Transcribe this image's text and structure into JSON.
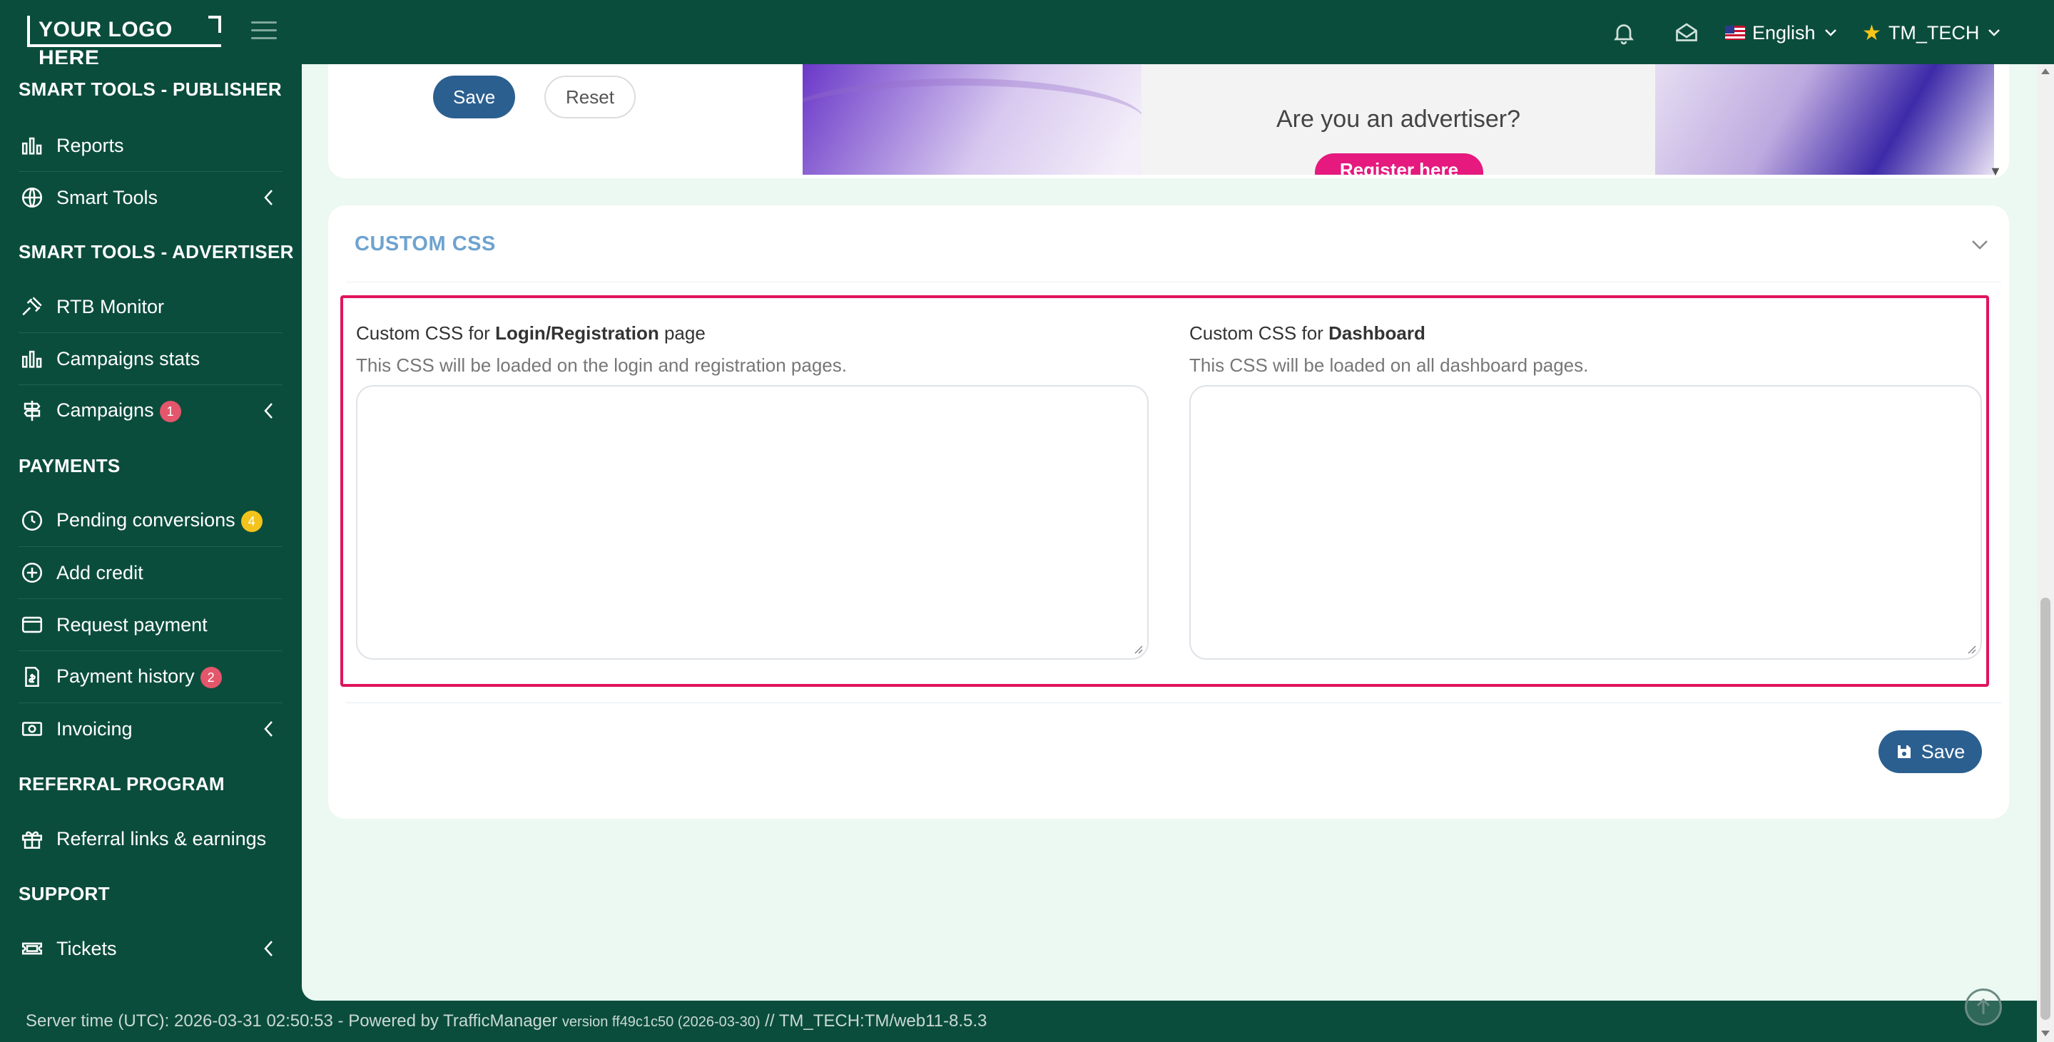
{
  "topbar": {
    "logo": "YOUR LOGO HERE",
    "language": "English",
    "user": "TM_TECH"
  },
  "sidebar": {
    "publisher_title": "SMART TOOLS - PUBLISHER",
    "publisher_items": [
      {
        "label": "Reports"
      },
      {
        "label": "Smart Tools"
      }
    ],
    "advertiser_title": "SMART TOOLS - ADVERTISER",
    "advertiser_items": [
      {
        "label": "RTB Monitor"
      },
      {
        "label": "Campaigns stats"
      },
      {
        "label": "Campaigns",
        "badge": "1"
      }
    ],
    "payments_title": "PAYMENTS",
    "payments_items": [
      {
        "label": "Pending conversions",
        "badge": "4"
      },
      {
        "label": "Add credit"
      },
      {
        "label": "Request payment"
      },
      {
        "label": "Payment history",
        "badge": "2"
      },
      {
        "label": "Invoicing"
      }
    ],
    "referral_title": "REFERRAL PROGRAM",
    "referral_items": [
      {
        "label": "Referral links & earnings"
      }
    ],
    "support_title": "SUPPORT",
    "support_items": [
      {
        "label": "Tickets"
      }
    ]
  },
  "top_card": {
    "save_label": "Save",
    "reset_label": "Reset",
    "preview_question": "Are you an advertiser?",
    "preview_button": "Register here"
  },
  "custom_css": {
    "title": "CUSTOM CSS",
    "login_label_prefix": "Custom CSS for ",
    "login_label_bold": "Login/Registration",
    "login_label_suffix": " page",
    "login_help": "This CSS will be loaded on the login and registration pages.",
    "login_value": "",
    "dashboard_label_prefix": "Custom CSS for ",
    "dashboard_label_bold": "Dashboard",
    "dashboard_help": "This CSS will be loaded on all dashboard pages.",
    "dashboard_value": "",
    "save_label": "Save"
  },
  "footer": {
    "server_time": "Server time (UTC): 2026-03-31 02:50:53 - Powered by TrafficManager",
    "version": "version ff49c1c50 (2026-03-30)",
    "instance": "// TM_TECH:TM/web11-8.5.3"
  },
  "colors": {
    "sidebar_bg": "#0b4d3c",
    "content_bg": "#ecf8f2",
    "accent_blue": "#2b5f90",
    "highlight_border": "#e0145d",
    "badge_red": "#e4566b",
    "badge_yellow": "#f3c31b",
    "section_title": "#6ea3cf"
  }
}
